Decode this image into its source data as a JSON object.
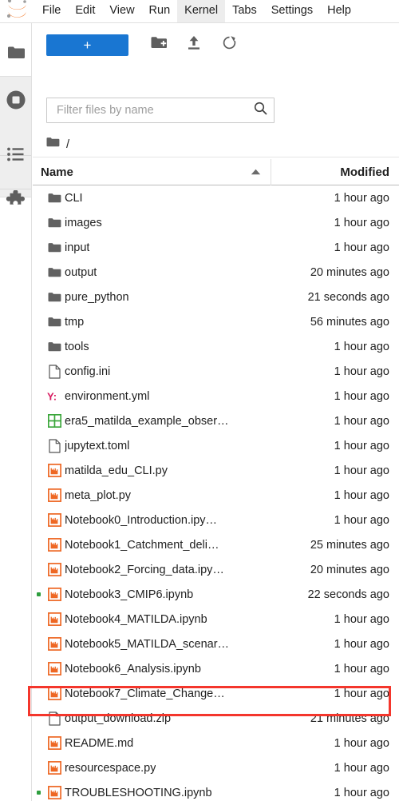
{
  "app": {
    "logo_icon": "jupyter-logo"
  },
  "menubar": {
    "items": [
      {
        "label": "File",
        "active": false
      },
      {
        "label": "Edit",
        "active": false
      },
      {
        "label": "View",
        "active": false
      },
      {
        "label": "Run",
        "active": false
      },
      {
        "label": "Kernel",
        "active": true
      },
      {
        "label": "Tabs",
        "active": false
      },
      {
        "label": "Settings",
        "active": false
      },
      {
        "label": "Help",
        "active": false
      }
    ]
  },
  "activitybar": {
    "items": [
      {
        "name": "file-browser",
        "icon": "folder-icon",
        "selected": true
      },
      {
        "name": "running-sessions",
        "icon": "stop-circle-icon",
        "selected": false
      },
      {
        "name": "table-of-contents",
        "icon": "list-icon",
        "selected": false
      },
      {
        "name": "extension-manager",
        "icon": "puzzle-piece-icon",
        "selected": false
      }
    ]
  },
  "toolbar": {
    "new_launcher_label": "+",
    "new_folder_icon": "new-folder-icon",
    "upload_icon": "upload-icon",
    "refresh_icon": "refresh-icon"
  },
  "filter": {
    "placeholder": "Filter files by name",
    "value": "",
    "search_icon": "search-icon"
  },
  "breadcrumb": {
    "root_icon": "folder-icon",
    "path": "/"
  },
  "columns": {
    "name": "Name",
    "modified": "Modified",
    "sort_by": "name",
    "sort_direction": "ascending",
    "sort_icon": "triangle-up-icon"
  },
  "accent_colors": {
    "new_button": "#1976d2",
    "notebook_icon": "#ee6723",
    "yaml_icon": "#d81b60",
    "csv_icon": "#3aa63a",
    "running_dot": "#2e9e3e",
    "annotation_box": "#f4362c"
  },
  "annotation": {
    "type": "red-rectangle-highlight",
    "target_row": "output_download.zip"
  },
  "files": [
    {
      "name": "CLI",
      "modified": "1 hour ago",
      "icon": "folder-icon",
      "running": false,
      "highlighted": false
    },
    {
      "name": "images",
      "modified": "1 hour ago",
      "icon": "folder-icon",
      "running": false,
      "highlighted": false
    },
    {
      "name": "input",
      "modified": "1 hour ago",
      "icon": "folder-icon",
      "running": false,
      "highlighted": false
    },
    {
      "name": "output",
      "modified": "20 minutes ago",
      "icon": "folder-icon",
      "running": false,
      "highlighted": false
    },
    {
      "name": "pure_python",
      "modified": "21 seconds ago",
      "icon": "folder-icon",
      "running": false,
      "highlighted": false
    },
    {
      "name": "tmp",
      "modified": "56 minutes ago",
      "icon": "folder-icon",
      "running": false,
      "highlighted": false
    },
    {
      "name": "tools",
      "modified": "1 hour ago",
      "icon": "folder-icon",
      "running": false,
      "highlighted": false
    },
    {
      "name": "config.ini",
      "modified": "1 hour ago",
      "icon": "file-icon",
      "running": false,
      "highlighted": false
    },
    {
      "name": "environment.yml",
      "modified": "1 hour ago",
      "icon": "yaml-icon",
      "running": false,
      "highlighted": false
    },
    {
      "name": "era5_matilda_example_obser…",
      "modified": "1 hour ago",
      "icon": "csv-icon",
      "running": false,
      "highlighted": false
    },
    {
      "name": "jupytext.toml",
      "modified": "1 hour ago",
      "icon": "file-icon",
      "running": false,
      "highlighted": false
    },
    {
      "name": "matilda_edu_CLI.py",
      "modified": "1 hour ago",
      "icon": "notebook-icon",
      "running": false,
      "highlighted": false
    },
    {
      "name": "meta_plot.py",
      "modified": "1 hour ago",
      "icon": "notebook-icon",
      "running": false,
      "highlighted": false
    },
    {
      "name": "Notebook0_Introduction.ipy…",
      "modified": "1 hour ago",
      "icon": "notebook-icon",
      "running": false,
      "highlighted": false
    },
    {
      "name": "Notebook1_Catchment_deli…",
      "modified": "25 minutes ago",
      "icon": "notebook-icon",
      "running": false,
      "highlighted": false
    },
    {
      "name": "Notebook2_Forcing_data.ipy…",
      "modified": "20 minutes ago",
      "icon": "notebook-icon",
      "running": false,
      "highlighted": false
    },
    {
      "name": "Notebook3_CMIP6.ipynb",
      "modified": "22 seconds ago",
      "icon": "notebook-icon",
      "running": true,
      "highlighted": false
    },
    {
      "name": "Notebook4_MATILDA.ipynb",
      "modified": "1 hour ago",
      "icon": "notebook-icon",
      "running": false,
      "highlighted": false
    },
    {
      "name": "Notebook5_MATILDA_scenar…",
      "modified": "1 hour ago",
      "icon": "notebook-icon",
      "running": false,
      "highlighted": false
    },
    {
      "name": "Notebook6_Analysis.ipynb",
      "modified": "1 hour ago",
      "icon": "notebook-icon",
      "running": false,
      "highlighted": false
    },
    {
      "name": "Notebook7_Climate_Change…",
      "modified": "1 hour ago",
      "icon": "notebook-icon",
      "running": false,
      "highlighted": false
    },
    {
      "name": "output_download.zip",
      "modified": "21 minutes ago",
      "icon": "file-icon",
      "running": false,
      "highlighted": true
    },
    {
      "name": "README.md",
      "modified": "1 hour ago",
      "icon": "notebook-icon",
      "running": false,
      "highlighted": false
    },
    {
      "name": "resourcespace.py",
      "modified": "1 hour ago",
      "icon": "notebook-icon",
      "running": false,
      "highlighted": false
    },
    {
      "name": "TROUBLESHOOTING.ipynb",
      "modified": "1 hour ago",
      "icon": "notebook-icon",
      "running": true,
      "highlighted": false
    }
  ]
}
